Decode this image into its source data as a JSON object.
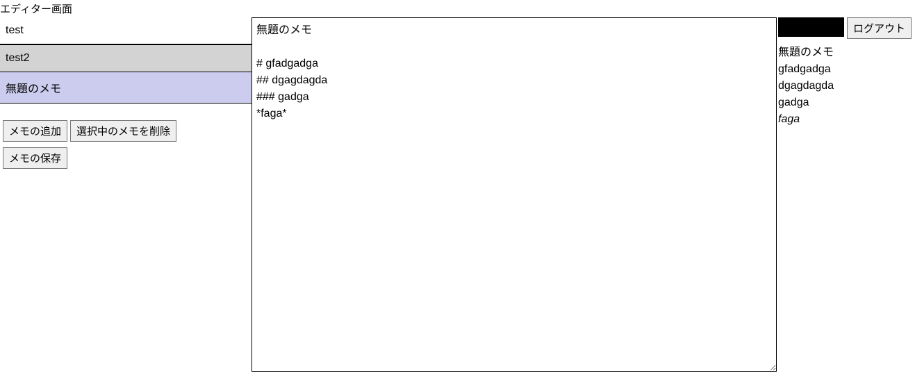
{
  "page_title": "エディター画面",
  "sidebar": {
    "memos": [
      {
        "label": "test"
      },
      {
        "label": "test2"
      },
      {
        "label": "無題のメモ"
      }
    ],
    "buttons": {
      "add_memo": "メモの追加",
      "delete_selected": "選択中のメモを削除",
      "save_memo": "メモの保存"
    }
  },
  "editor": {
    "content": "無題のメモ\n\n# gfadgadga\n## dgagdagda\n### gadga\n*faga*"
  },
  "right": {
    "logout": "ログアウト"
  },
  "preview": {
    "title": "無題のメモ",
    "h1": "gfadgadga",
    "h2": "dgagdagda",
    "h3": "gadga",
    "italic": "faga"
  }
}
